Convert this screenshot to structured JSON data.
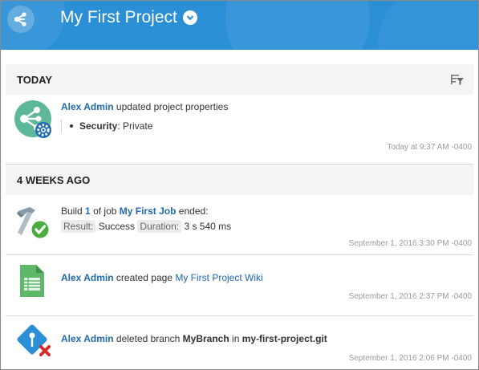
{
  "header": {
    "project_title": "My First Project",
    "brand_color": "#2b8fd6"
  },
  "sections": [
    {
      "title": "TODAY"
    },
    {
      "title": "4 WEEKS AGO"
    }
  ],
  "activities": {
    "project_update": {
      "actor": "Alex Admin",
      "action": "updated project properties",
      "detail_label": "Security",
      "detail_sep": ":",
      "detail_value": "Private",
      "timestamp": "Today at 9:37 AM -0400",
      "icon": "project-settings-icon"
    },
    "build": {
      "prefix": "Build",
      "build_number": "1",
      "mid": "of job",
      "job_name": "My First Job",
      "suffix": "ended:",
      "result_label": "Result:",
      "result_value": "Success",
      "duration_label": "Duration:",
      "duration_value": "3 s 540 ms",
      "timestamp": "September 1, 2016 3:30 PM -0400",
      "icon": "build-hammer-success-icon"
    },
    "wiki": {
      "actor": "Alex Admin",
      "action": "created page",
      "page_name": "My First Project Wiki",
      "timestamp": "September 1, 2016 2:37 PM -0400",
      "icon": "wiki-page-icon"
    },
    "branch": {
      "actor": "Alex Admin",
      "action": "deleted branch",
      "branch_name": "MyBranch",
      "in_word": "in",
      "repo_name": "my-first-project.git",
      "timestamp": "September 1, 2016 2:06 PM -0400",
      "icon": "branch-delete-icon"
    }
  }
}
